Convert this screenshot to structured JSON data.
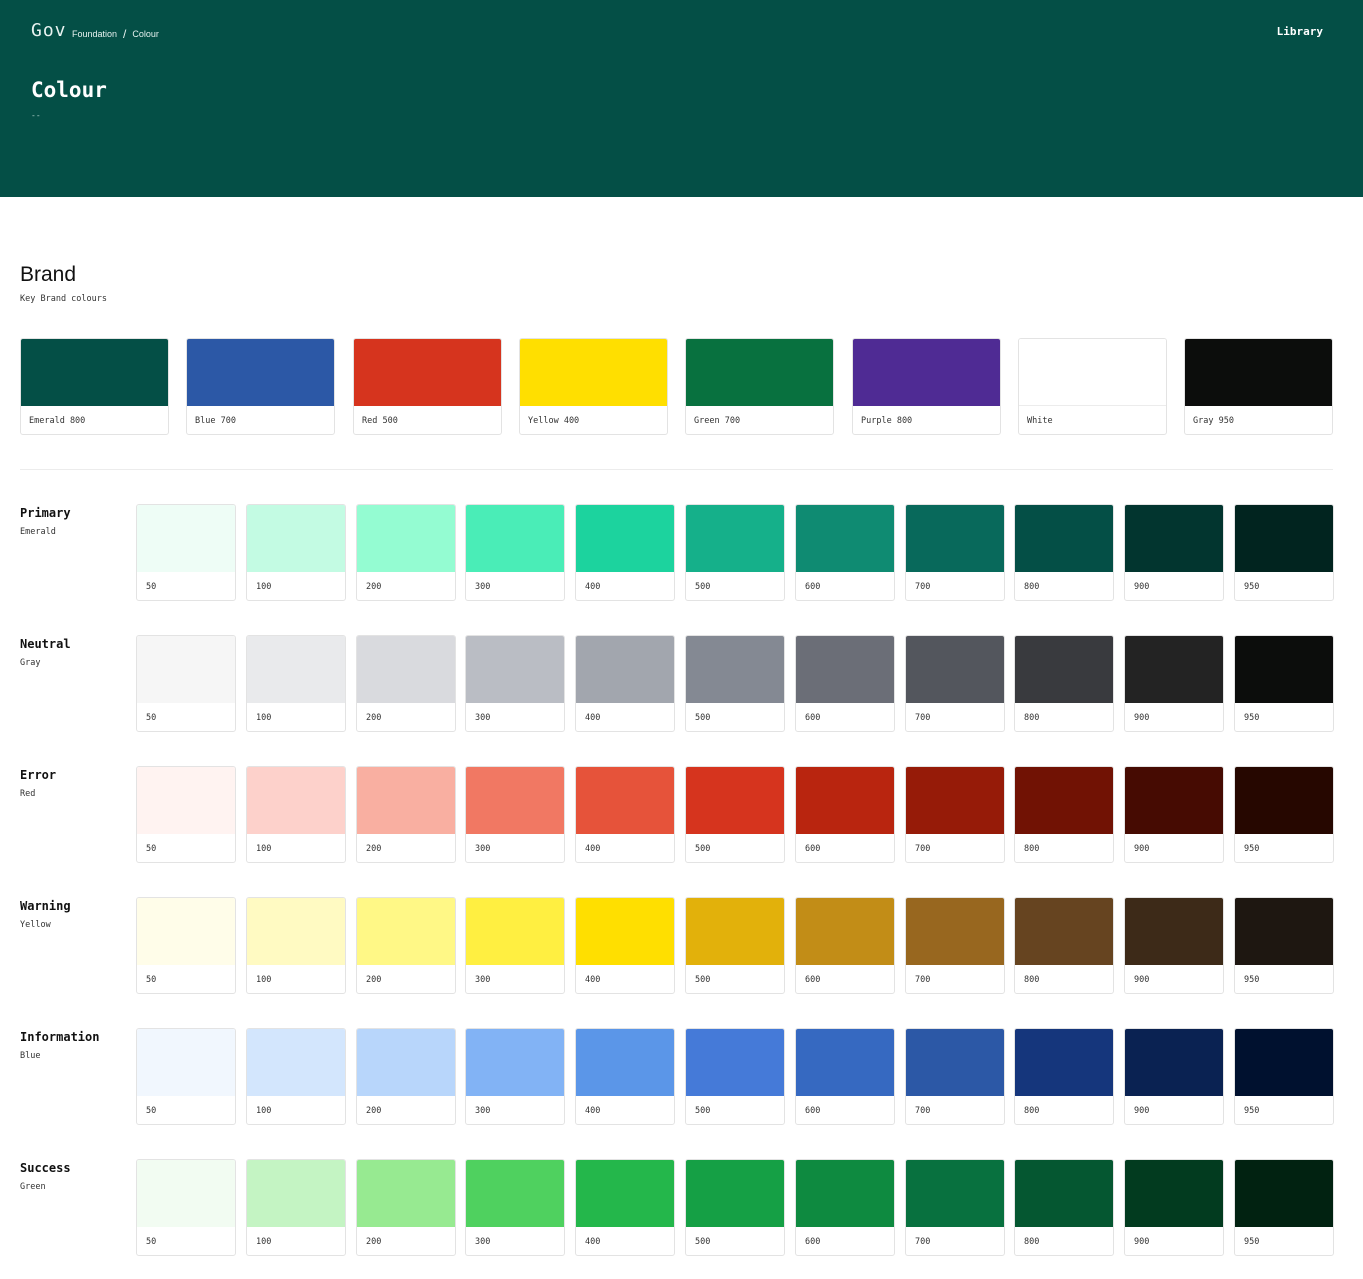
{
  "header": {
    "logo": "Gov",
    "breadcrumb": [
      "Foundation",
      "Colour"
    ],
    "breadcrumb_sep": "/",
    "nav_link": "Library",
    "title": "Colour",
    "subtitle": "--",
    "background": "#044f46"
  },
  "brand": {
    "title": "Brand",
    "subtitle": "Key Brand colours",
    "swatches": [
      {
        "name": "Emerald 800",
        "color": "#044f46"
      },
      {
        "name": "Blue 700",
        "color": "#2c58a6"
      },
      {
        "name": "Red 500",
        "color": "#d6341e"
      },
      {
        "name": "Yellow 400",
        "color": "#ffdf00"
      },
      {
        "name": "Green 700",
        "color": "#08713f"
      },
      {
        "name": "Purple 800",
        "color": "#4f2b94"
      },
      {
        "name": "White",
        "color": "#ffffff"
      },
      {
        "name": "Gray 950",
        "color": "#0c0d0c"
      }
    ]
  },
  "scales": [
    {
      "title": "Primary",
      "subtitle": "Emerald",
      "steps": [
        "50",
        "100",
        "200",
        "300",
        "400",
        "500",
        "600",
        "700",
        "800",
        "900",
        "950"
      ],
      "colors": [
        "#eefdf6",
        "#c3fbe3",
        "#94fcd2",
        "#4aedb7",
        "#1cd39e",
        "#15b08a",
        "#0f8b72",
        "#08695b",
        "#044f46",
        "#02352f",
        "#01241f"
      ]
    },
    {
      "title": "Neutral",
      "subtitle": "Gray",
      "steps": [
        "50",
        "100",
        "200",
        "300",
        "400",
        "500",
        "600",
        "700",
        "800",
        "900",
        "950"
      ],
      "colors": [
        "#f6f6f6",
        "#e9eaec",
        "#d9dade",
        "#babdc4",
        "#a2a6ae",
        "#848993",
        "#6b6e77",
        "#53565d",
        "#393a3e",
        "#232323",
        "#0c0d0c"
      ]
    },
    {
      "title": "Error",
      "subtitle": "Red",
      "steps": [
        "50",
        "100",
        "200",
        "300",
        "400",
        "500",
        "600",
        "700",
        "800",
        "900",
        "950"
      ],
      "colors": [
        "#fff3f1",
        "#fdd1cb",
        "#f9afa1",
        "#f17863",
        "#e6533a",
        "#d6341e",
        "#b9250f",
        "#961b08",
        "#711204",
        "#460b02",
        "#260700"
      ]
    },
    {
      "title": "Warning",
      "subtitle": "Yellow",
      "steps": [
        "50",
        "100",
        "200",
        "300",
        "400",
        "500",
        "600",
        "700",
        "800",
        "900",
        "950"
      ],
      "colors": [
        "#fffde9",
        "#fffac2",
        "#fff886",
        "#ffef41",
        "#ffdf00",
        "#e2b10b",
        "#c28d17",
        "#98671f",
        "#664420",
        "#3d2a18",
        "#1e1711"
      ]
    },
    {
      "title": "Information",
      "subtitle": "Blue",
      "steps": [
        "50",
        "100",
        "200",
        "300",
        "400",
        "500",
        "600",
        "700",
        "800",
        "900",
        "950"
      ],
      "colors": [
        "#f1f7fe",
        "#d3e6fd",
        "#b8d6fb",
        "#82b3f5",
        "#5b96e8",
        "#457ad8",
        "#3669c1",
        "#2c58a6",
        "#15367c",
        "#0a2252",
        "#00112f"
      ]
    },
    {
      "title": "Success",
      "subtitle": "Green",
      "steps": [
        "50",
        "100",
        "200",
        "300",
        "400",
        "500",
        "600",
        "700",
        "800",
        "900",
        "950"
      ],
      "colors": [
        "#f2fcf2",
        "#c4f4c3",
        "#97ea91",
        "#4fd15f",
        "#24b74b",
        "#15a045",
        "#0e8a40",
        "#08713f",
        "#055731",
        "#023b1f",
        "#012211"
      ]
    }
  ]
}
